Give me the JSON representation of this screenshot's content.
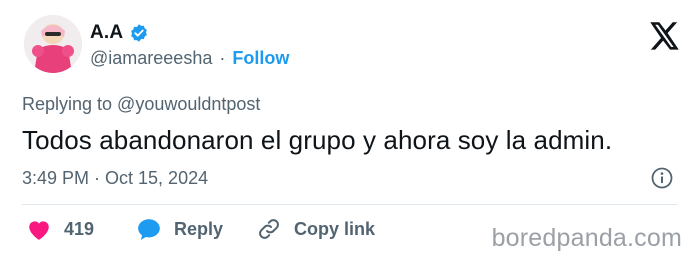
{
  "author": {
    "display_name": "A.A",
    "handle": "@iamareeesha",
    "separator": "·",
    "follow_label": "Follow"
  },
  "tweet": {
    "replying_to": "Replying to @youwouldntpost",
    "text": "Todos abandonaron el grupo y ahora soy la admin.",
    "timestamp": "3:49 PM · Oct 15, 2024"
  },
  "actions": {
    "likes_count": "419",
    "reply_label": "Reply",
    "copy_link_label": "Copy link"
  },
  "watermark": "boredpanda.com",
  "icons": {
    "verified": "verified-badge-icon",
    "brand": "x-logo-icon",
    "info": "info-icon",
    "like": "heart-icon",
    "reply": "speech-bubble-icon",
    "copy": "link-icon"
  },
  "colors": {
    "accent": "#1d9bf0",
    "heart": "#f91880",
    "secondary_text": "#536471",
    "primary_text": "#0f1419",
    "avatar_pink": "#e8407a"
  }
}
